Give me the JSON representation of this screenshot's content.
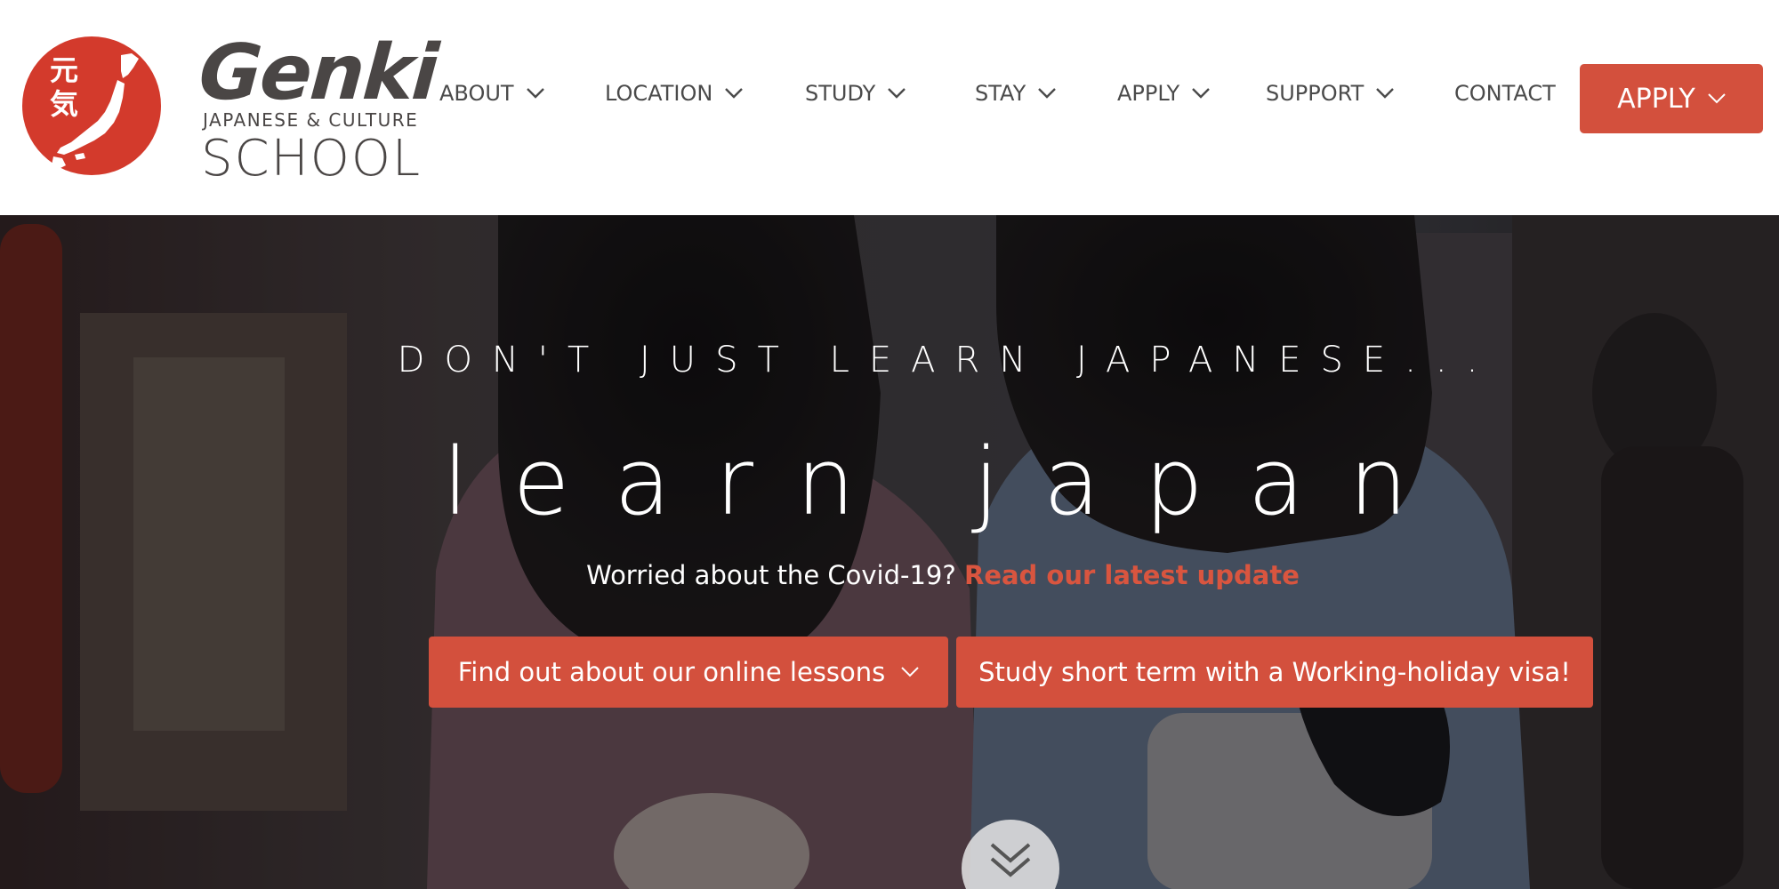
{
  "logo": {
    "kanji_top": "元",
    "kanji_bottom": "気",
    "brand": "Genki",
    "subtitle": "JAPANESE & CULTURE",
    "school": "SCHOOL"
  },
  "nav": {
    "items": [
      {
        "label": "ABOUT",
        "has_dropdown": true
      },
      {
        "label": "LOCATION",
        "has_dropdown": true
      },
      {
        "label": "STUDY",
        "has_dropdown": true
      },
      {
        "label": "STAY",
        "has_dropdown": true
      },
      {
        "label": "APPLY",
        "has_dropdown": true
      },
      {
        "label": "SUPPORT",
        "has_dropdown": true
      },
      {
        "label": "CONTACT",
        "has_dropdown": false
      }
    ],
    "apply_button": "APPLY"
  },
  "hero": {
    "tagline": "DON'T JUST LEARN JAPANESE...",
    "headline": "learn japan",
    "covid_text": "Worried about the Covid-19?",
    "covid_link": "Read our latest update",
    "cta_online": "Find out about our online lessons",
    "cta_working_holiday": "Study short term with a Working-holiday visa!"
  },
  "colors": {
    "accent": "#d3503d",
    "link": "#d9553f",
    "text_dark": "#4a4645",
    "white": "#ffffff"
  },
  "icons": {
    "dropdown": "chevron-down-icon",
    "scroll": "double-chevron-down-icon",
    "logo": "japan-map-circle-logo"
  }
}
